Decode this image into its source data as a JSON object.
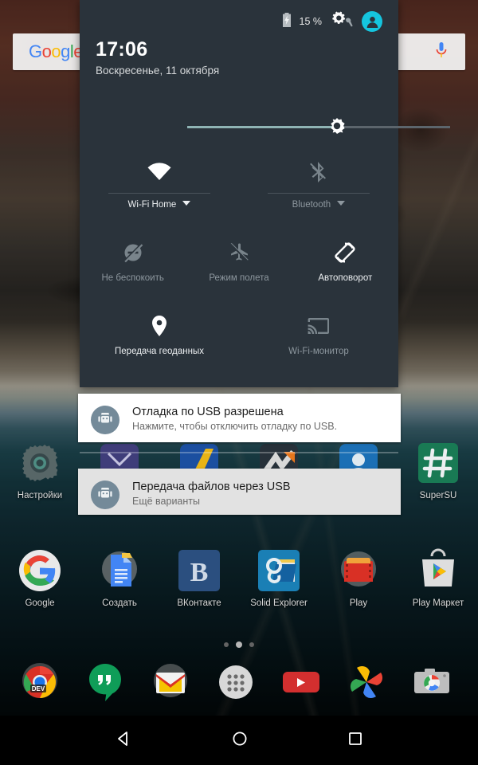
{
  "search_widget": {
    "logo_letters": [
      "G",
      "o",
      "o",
      "g",
      "l",
      "e"
    ],
    "mic_icon": "microphone-icon"
  },
  "quick_settings": {
    "battery_percent": "15 %",
    "battery_icon": "battery-charging-icon",
    "settings_icon": "gear-wrench-icon",
    "avatar_icon": "user-avatar-icon",
    "time": "17:06",
    "date": "Воскресенье, 11 октября",
    "brightness": {
      "icon": "brightness-sun-icon",
      "value_percent": 57
    },
    "tiles_row1": [
      {
        "label": "Wi-Fi Home",
        "icon": "wifi-icon",
        "state": "on",
        "has_caret": true
      },
      {
        "label": "Bluetooth",
        "icon": "bluetooth-disabled-icon",
        "state": "off",
        "has_caret": true
      }
    ],
    "tiles_row2": [
      {
        "label": "Не беспокоить",
        "icon": "do-not-disturb-icon",
        "state": "off"
      },
      {
        "label": "Режим полета",
        "icon": "airplane-mode-icon",
        "state": "off"
      },
      {
        "label": "Автоповорот",
        "icon": "auto-rotate-icon",
        "state": "on"
      }
    ],
    "tiles_row3": [
      {
        "label": "Передача геоданных",
        "icon": "location-pin-icon",
        "state": "on"
      },
      {
        "label": "Wi-Fi-монитор",
        "icon": "cast-screen-icon",
        "state": "off"
      }
    ]
  },
  "notifications": [
    {
      "icon": "android-robot-icon",
      "title": "Отладка по USB разрешена",
      "subtitle": "Нажмите, чтобы отключить отладку по USB."
    },
    {
      "icon": "android-robot-icon",
      "title": "Передача файлов через USB",
      "subtitle": "Ещё варианты"
    }
  ],
  "home_screen": {
    "side_apps": [
      {
        "label": "Настройки",
        "icon": "settings-gear-icon"
      },
      {
        "label": "SuperSU",
        "icon": "supersu-hash-icon"
      }
    ],
    "app_row": [
      {
        "label": "Google",
        "icon": "google-g-icon"
      },
      {
        "label": "Создать",
        "icon": "google-docs-icon"
      },
      {
        "label": "ВКонтакте",
        "icon": "vkontakte-icon"
      },
      {
        "label": "Solid Explorer",
        "icon": "solid-explorer-icon"
      },
      {
        "label": "Play",
        "icon": "google-play-movies-icon"
      },
      {
        "label": "Play Маркет",
        "icon": "play-store-icon"
      }
    ],
    "page_dots": {
      "count": 3,
      "active_index": 1
    },
    "dock": [
      {
        "icon": "chrome-dev-icon",
        "badge": "DEV"
      },
      {
        "icon": "hangouts-icon"
      },
      {
        "icon": "gmail-icon"
      },
      {
        "icon": "app-drawer-icon"
      },
      {
        "icon": "youtube-icon"
      },
      {
        "icon": "google-photos-icon"
      },
      {
        "icon": "camera-icon"
      }
    ]
  },
  "nav_bar": {
    "back": "back-triangle-icon",
    "home": "home-circle-icon",
    "recents": "recents-square-icon"
  },
  "colors": {
    "panel": "#2a333b",
    "accent_cyan": "#15c5de",
    "notification_white": "#ffffff",
    "notification_grey": "#e2e2e2"
  }
}
